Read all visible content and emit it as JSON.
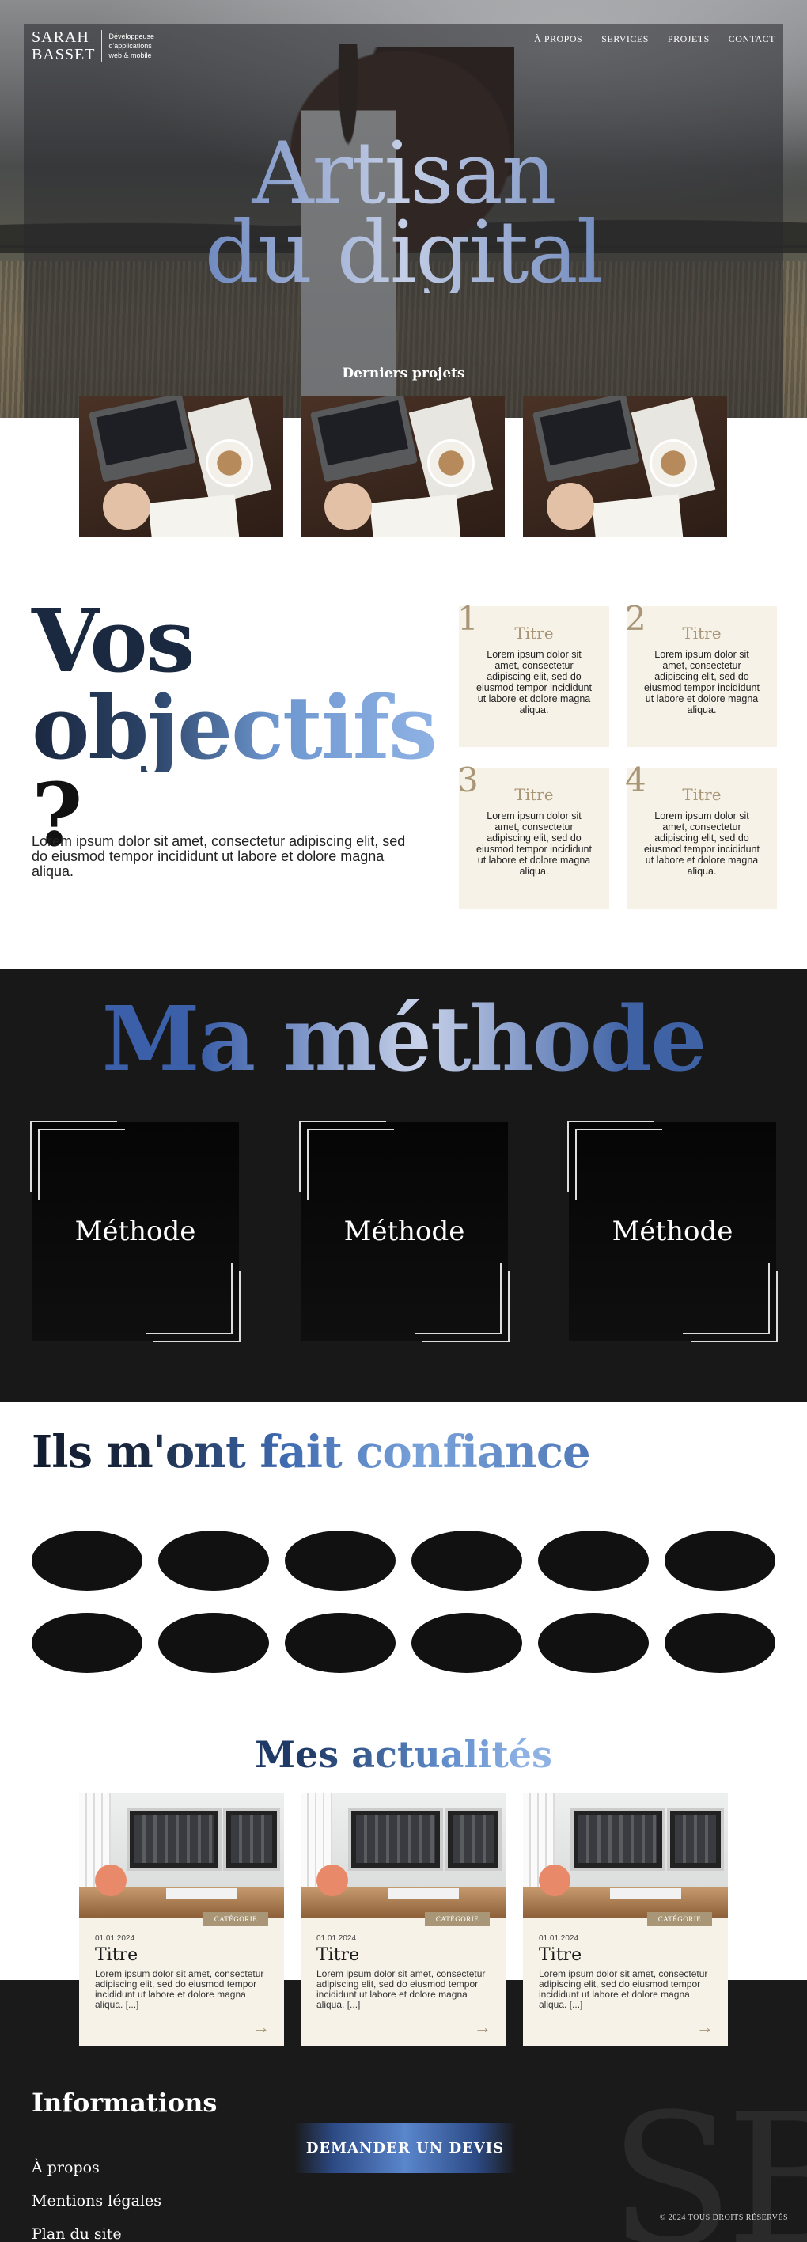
{
  "brand": {
    "line1": "SARAH",
    "line2": "BASSET",
    "tagline1": "Développeuse",
    "tagline2": "d'applications",
    "tagline3": "web & mobile"
  },
  "nav": [
    "À PROPOS",
    "SERVICES",
    "PROJETS",
    "CONTACT"
  ],
  "hero": {
    "title_line1": "Artisan",
    "title_line2": "du digital",
    "projects_label": "Derniers projets"
  },
  "objectives": {
    "title_line1": "Vos",
    "title_line2": "objectifs",
    "title_line3": "?",
    "text": "Lorem ipsum dolor sit amet, consectetur adipiscing elit, sed do eiusmod tempor incididunt ut labore et dolore magna aliqua.",
    "items": [
      {
        "num": "1",
        "title": "Titre",
        "text": "Lorem ipsum dolor sit amet, consectetur adipiscing elit, sed do eiusmod tempor incididunt ut labore et dolore magna aliqua."
      },
      {
        "num": "2",
        "title": "Titre",
        "text": "Lorem ipsum dolor sit amet, consectetur adipiscing elit, sed do eiusmod tempor incididunt ut labore et dolore magna aliqua."
      },
      {
        "num": "3",
        "title": "Titre",
        "text": "Lorem ipsum dolor sit amet, consectetur adipiscing elit, sed do eiusmod tempor incididunt ut labore et dolore magna aliqua."
      },
      {
        "num": "4",
        "title": "Titre",
        "text": "Lorem ipsum dolor sit amet, consectetur adipiscing elit, sed do eiusmod tempor incididunt ut labore et dolore magna aliqua."
      }
    ]
  },
  "method": {
    "title": "Ma méthode",
    "cards": [
      "Méthode",
      "Méthode",
      "Méthode"
    ]
  },
  "trust": {
    "title": "Ils m'ont fait confiance"
  },
  "news": {
    "title": "Mes actualités",
    "items": [
      {
        "category": "CATÉGORIE",
        "date": "01.01.2024",
        "title": "Titre",
        "text": "Lorem ipsum dolor sit amet, consectetur adipiscing elit, sed do eiusmod tempor incididunt ut labore et dolore magna aliqua. [...]",
        "arrow": "→"
      },
      {
        "category": "CATÉGORIE",
        "date": "01.01.2024",
        "title": "Titre",
        "text": "Lorem ipsum dolor sit amet, consectetur adipiscing elit, sed do eiusmod tempor incididunt ut labore et dolore magna aliqua. [...]",
        "arrow": "→"
      },
      {
        "category": "CATÉGORIE",
        "date": "01.01.2024",
        "title": "Titre",
        "text": "Lorem ipsum dolor sit amet, consectetur adipiscing elit, sed do eiusmod tempor incididunt ut labore et dolore magna aliqua. [...]",
        "arrow": "→"
      }
    ]
  },
  "footer": {
    "title": "Informations",
    "links": [
      "À propos",
      "Mentions légales",
      "Plan du site"
    ],
    "cta": "DEMANDER UN DEVIS",
    "copyright": "© 2024 TOUS DROITS RÉSERVÉS",
    "watermark": "SB"
  },
  "colors": {
    "accent_blue": "#5a86cc",
    "beige": "#a89676",
    "card_bg": "#f7f2e8",
    "dark": "#181818"
  }
}
